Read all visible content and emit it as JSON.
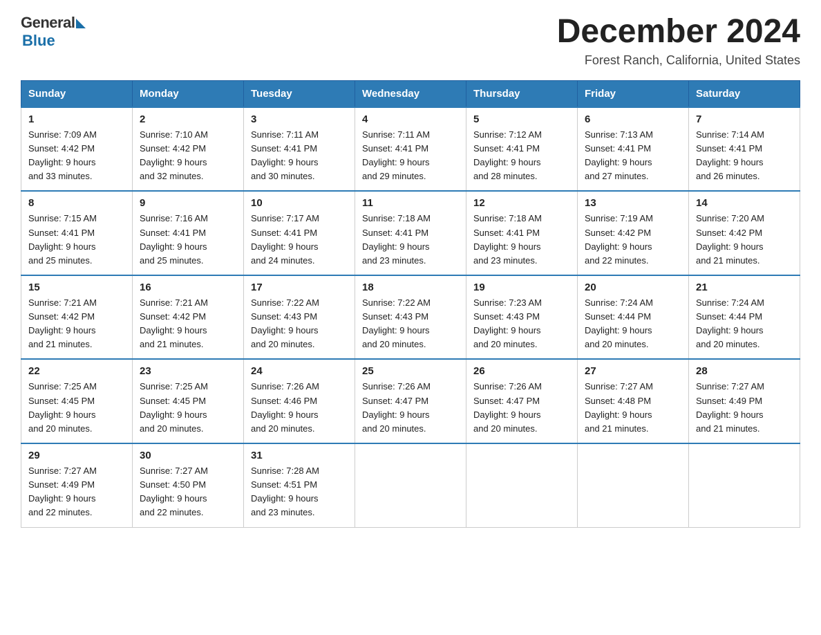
{
  "logo": {
    "general": "General",
    "blue": "Blue",
    "tagline": "Blue"
  },
  "title": "December 2024",
  "location": "Forest Ranch, California, United States",
  "days_of_week": [
    "Sunday",
    "Monday",
    "Tuesday",
    "Wednesday",
    "Thursday",
    "Friday",
    "Saturday"
  ],
  "weeks": [
    [
      {
        "day": "1",
        "sunrise": "7:09 AM",
        "sunset": "4:42 PM",
        "daylight": "9 hours and 33 minutes."
      },
      {
        "day": "2",
        "sunrise": "7:10 AM",
        "sunset": "4:42 PM",
        "daylight": "9 hours and 32 minutes."
      },
      {
        "day": "3",
        "sunrise": "7:11 AM",
        "sunset": "4:41 PM",
        "daylight": "9 hours and 30 minutes."
      },
      {
        "day": "4",
        "sunrise": "7:11 AM",
        "sunset": "4:41 PM",
        "daylight": "9 hours and 29 minutes."
      },
      {
        "day": "5",
        "sunrise": "7:12 AM",
        "sunset": "4:41 PM",
        "daylight": "9 hours and 28 minutes."
      },
      {
        "day": "6",
        "sunrise": "7:13 AM",
        "sunset": "4:41 PM",
        "daylight": "9 hours and 27 minutes."
      },
      {
        "day": "7",
        "sunrise": "7:14 AM",
        "sunset": "4:41 PM",
        "daylight": "9 hours and 26 minutes."
      }
    ],
    [
      {
        "day": "8",
        "sunrise": "7:15 AM",
        "sunset": "4:41 PM",
        "daylight": "9 hours and 25 minutes."
      },
      {
        "day": "9",
        "sunrise": "7:16 AM",
        "sunset": "4:41 PM",
        "daylight": "9 hours and 25 minutes."
      },
      {
        "day": "10",
        "sunrise": "7:17 AM",
        "sunset": "4:41 PM",
        "daylight": "9 hours and 24 minutes."
      },
      {
        "day": "11",
        "sunrise": "7:18 AM",
        "sunset": "4:41 PM",
        "daylight": "9 hours and 23 minutes."
      },
      {
        "day": "12",
        "sunrise": "7:18 AM",
        "sunset": "4:41 PM",
        "daylight": "9 hours and 23 minutes."
      },
      {
        "day": "13",
        "sunrise": "7:19 AM",
        "sunset": "4:42 PM",
        "daylight": "9 hours and 22 minutes."
      },
      {
        "day": "14",
        "sunrise": "7:20 AM",
        "sunset": "4:42 PM",
        "daylight": "9 hours and 21 minutes."
      }
    ],
    [
      {
        "day": "15",
        "sunrise": "7:21 AM",
        "sunset": "4:42 PM",
        "daylight": "9 hours and 21 minutes."
      },
      {
        "day": "16",
        "sunrise": "7:21 AM",
        "sunset": "4:42 PM",
        "daylight": "9 hours and 21 minutes."
      },
      {
        "day": "17",
        "sunrise": "7:22 AM",
        "sunset": "4:43 PM",
        "daylight": "9 hours and 20 minutes."
      },
      {
        "day": "18",
        "sunrise": "7:22 AM",
        "sunset": "4:43 PM",
        "daylight": "9 hours and 20 minutes."
      },
      {
        "day": "19",
        "sunrise": "7:23 AM",
        "sunset": "4:43 PM",
        "daylight": "9 hours and 20 minutes."
      },
      {
        "day": "20",
        "sunrise": "7:24 AM",
        "sunset": "4:44 PM",
        "daylight": "9 hours and 20 minutes."
      },
      {
        "day": "21",
        "sunrise": "7:24 AM",
        "sunset": "4:44 PM",
        "daylight": "9 hours and 20 minutes."
      }
    ],
    [
      {
        "day": "22",
        "sunrise": "7:25 AM",
        "sunset": "4:45 PM",
        "daylight": "9 hours and 20 minutes."
      },
      {
        "day": "23",
        "sunrise": "7:25 AM",
        "sunset": "4:45 PM",
        "daylight": "9 hours and 20 minutes."
      },
      {
        "day": "24",
        "sunrise": "7:26 AM",
        "sunset": "4:46 PM",
        "daylight": "9 hours and 20 minutes."
      },
      {
        "day": "25",
        "sunrise": "7:26 AM",
        "sunset": "4:47 PM",
        "daylight": "9 hours and 20 minutes."
      },
      {
        "day": "26",
        "sunrise": "7:26 AM",
        "sunset": "4:47 PM",
        "daylight": "9 hours and 20 minutes."
      },
      {
        "day": "27",
        "sunrise": "7:27 AM",
        "sunset": "4:48 PM",
        "daylight": "9 hours and 21 minutes."
      },
      {
        "day": "28",
        "sunrise": "7:27 AM",
        "sunset": "4:49 PM",
        "daylight": "9 hours and 21 minutes."
      }
    ],
    [
      {
        "day": "29",
        "sunrise": "7:27 AM",
        "sunset": "4:49 PM",
        "daylight": "9 hours and 22 minutes."
      },
      {
        "day": "30",
        "sunrise": "7:27 AM",
        "sunset": "4:50 PM",
        "daylight": "9 hours and 22 minutes."
      },
      {
        "day": "31",
        "sunrise": "7:28 AM",
        "sunset": "4:51 PM",
        "daylight": "9 hours and 23 minutes."
      },
      null,
      null,
      null,
      null
    ]
  ]
}
